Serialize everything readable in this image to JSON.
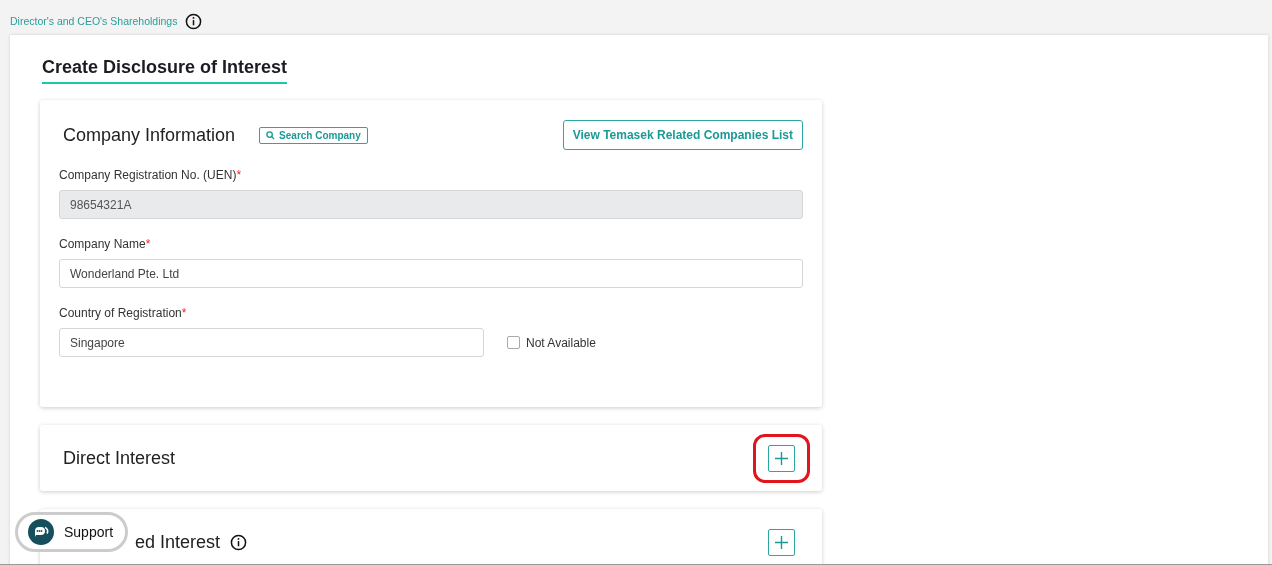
{
  "breadcrumb": {
    "label": "Director's and CEO's Shareholdings"
  },
  "page": {
    "title": "Create Disclosure of Interest"
  },
  "company_information": {
    "title": "Company Information",
    "search_button": "Search Company",
    "list_button": "View Temasek Related Companies List",
    "fields": [
      {
        "label": "Company Registration No. (UEN)",
        "required_mark": "*",
        "value": "98654321A",
        "disabled": true
      },
      {
        "label": "Company Name",
        "required_mark": "*",
        "value": "Wonderland Pte. Ltd",
        "disabled": false
      },
      {
        "label": "Country of Registration",
        "required_mark": "*",
        "value": "Singapore",
        "disabled": false,
        "checkbox": {
          "label": "Not Available",
          "checked": false
        }
      }
    ]
  },
  "sections": [
    {
      "title": "Direct Interest",
      "info": false,
      "highlighted": true,
      "covered": false
    },
    {
      "title": "ed Interest",
      "info": true,
      "highlighted": false,
      "covered": true
    }
  ],
  "support": {
    "label": "Support"
  }
}
